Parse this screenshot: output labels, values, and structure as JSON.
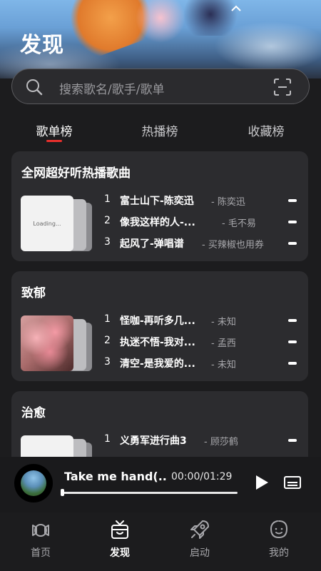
{
  "header": {
    "title": "发现"
  },
  "search": {
    "placeholder": "搜索歌名/歌手/歌单"
  },
  "tabs": [
    {
      "label": "歌单榜",
      "active": true
    },
    {
      "label": "热播榜",
      "active": false
    },
    {
      "label": "收藏榜",
      "active": false
    }
  ],
  "accent_color": "#e9302c",
  "playlists": [
    {
      "title": "全网超好听热播歌曲",
      "cover_text": "Loading...",
      "songs": [
        {
          "num": "1",
          "name": "富士山下-陈奕迅",
          "artist": "- 陈奕迅"
        },
        {
          "num": "2",
          "name": "像我这样的人-...",
          "artist": "- 毛不易"
        },
        {
          "num": "3",
          "name": "起风了-弹唱谱",
          "artist": "- 买辣椒也用券"
        }
      ]
    },
    {
      "title": "致郁",
      "cover_text": "",
      "songs": [
        {
          "num": "1",
          "name": "怪咖-再听多几...",
          "artist": "- 未知"
        },
        {
          "num": "2",
          "name": "执迷不悟-我对...",
          "artist": "- 孟西"
        },
        {
          "num": "3",
          "name": "清空-是我爱的...",
          "artist": "- 未知"
        }
      ]
    },
    {
      "title": "治愈",
      "cover_text": "",
      "songs": [
        {
          "num": "1",
          "name": "义勇军进行曲3",
          "artist": "- 顾莎鹤"
        }
      ]
    }
  ],
  "player": {
    "title": "Take me hand(..",
    "time": "00:00/01:29",
    "progress": 0.0
  },
  "nav": [
    {
      "label": "首页",
      "icon": "home-icon",
      "active": false
    },
    {
      "label": "发现",
      "icon": "discover-icon",
      "active": true
    },
    {
      "label": "启动",
      "icon": "rocket-icon",
      "active": false
    },
    {
      "label": "我的",
      "icon": "profile-icon",
      "active": false
    }
  ]
}
